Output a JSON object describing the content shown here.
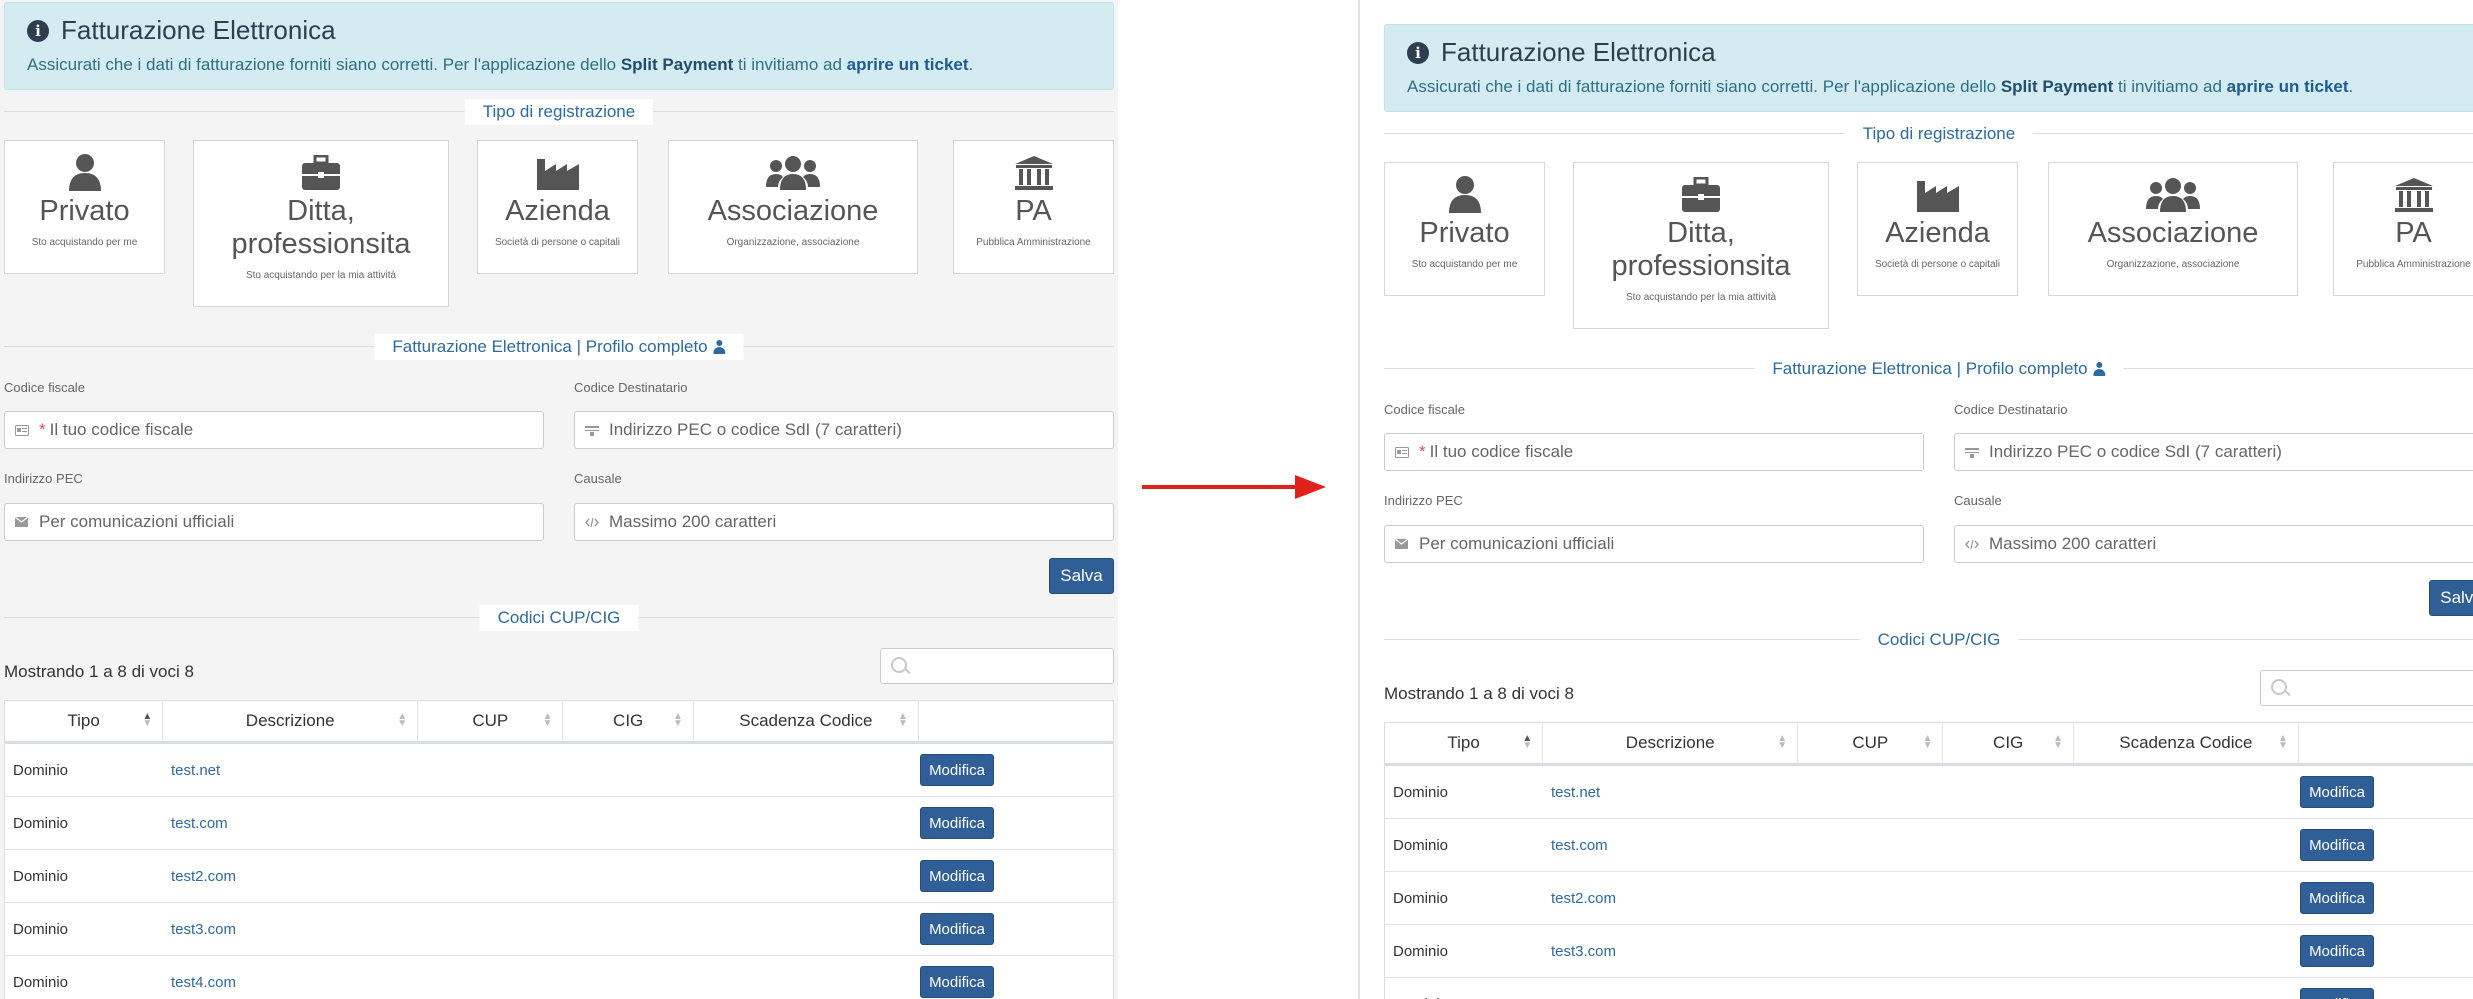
{
  "alert": {
    "title": "Fatturazione Elettronica",
    "text_prefix": "Assicurati che i dati di fatturazione forniti siano corretti. Per l'applicazione dello ",
    "text_bold": "Split Payment",
    "text_mid": " ti invitiamo ad ",
    "text_link": "aprire un ticket",
    "text_suffix": "."
  },
  "registration": {
    "section_label": "Tipo di registrazione",
    "cards": [
      {
        "title": "Privato",
        "subtitle": "Sto acquistando per me",
        "icon": "user-icon",
        "selected": true
      },
      {
        "title": "Ditta, professionsita",
        "subtitle": "Sto acquistando per la mia attività",
        "icon": "briefcase-icon",
        "selected": false
      },
      {
        "title": "Azienda",
        "subtitle": "Società di persone o capitali",
        "icon": "factory-icon",
        "selected": false
      },
      {
        "title": "Associazione",
        "subtitle": "Organizzazione, associazione",
        "icon": "users-icon",
        "selected": false
      },
      {
        "title": "PA",
        "subtitle": "Pubblica Amministrazione",
        "icon": "institution-icon",
        "selected": false
      }
    ]
  },
  "profile": {
    "section_label": "Fatturazione Elettronica | Profilo completo",
    "fields": {
      "codice_fiscale": {
        "label": "Codice fiscale",
        "placeholder": "Il tuo codice fiscale",
        "required": "*",
        "icon": "id-card-icon"
      },
      "codice_destinatario": {
        "label": "Codice Destinatario",
        "placeholder": "Indirizzo PEC o codice SdI (7 caratteri)",
        "icon": "barcode-icon"
      },
      "indirizzo_pec": {
        "label": "Indirizzo PEC",
        "placeholder": "Per comunicazioni ufficiali",
        "icon": "envelope-icon"
      },
      "causale": {
        "label": "Causale",
        "placeholder": "Massimo 200 caratteri",
        "icon": "code-icon"
      }
    },
    "save_label": "Salva"
  },
  "codes": {
    "section_label": "Codici CUP/CIG",
    "count_text": "Mostrando 1 a 8 di voci 8",
    "columns": [
      "Tipo",
      "Descrizione",
      "CUP",
      "CIG",
      "Scadenza Codice",
      ""
    ],
    "rows": [
      {
        "tipo": "Dominio",
        "descrizione": "test.net",
        "action": "Modifica"
      },
      {
        "tipo": "Dominio",
        "descrizione": "test.com",
        "action": "Modifica"
      },
      {
        "tipo": "Dominio",
        "descrizione": "test2.com",
        "action": "Modifica"
      },
      {
        "tipo": "Dominio",
        "descrizione": "test3.com",
        "action": "Modifica"
      },
      {
        "tipo": "Dominio",
        "descrizione": "test4.com",
        "action": "Modifica"
      }
    ]
  },
  "colors": {
    "accent": "#2f5f96",
    "selected": "#c5efbc",
    "arrow": "#e0201b",
    "alert_bg": "#d4ecf1"
  }
}
